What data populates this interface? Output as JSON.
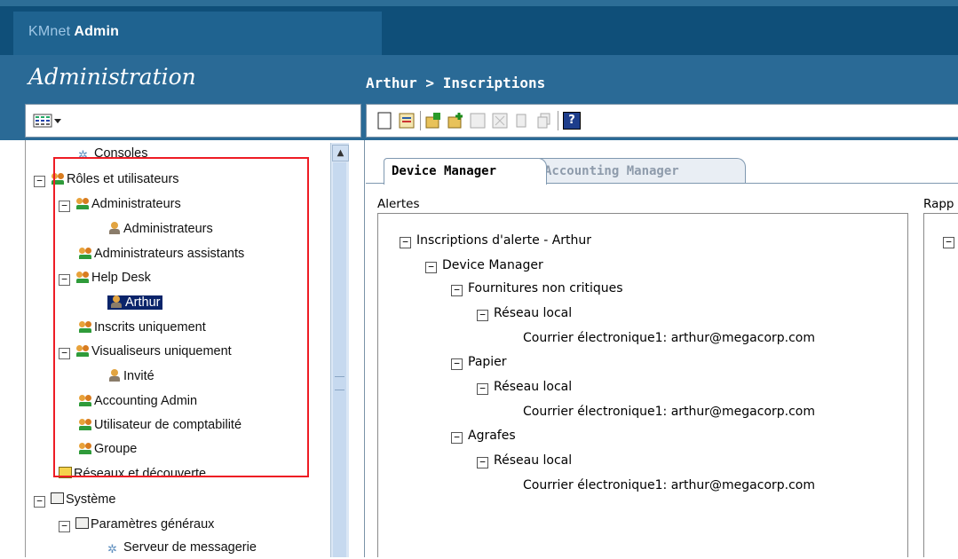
{
  "app": {
    "logo_km": "KMnet",
    "logo_admin": "Admin"
  },
  "left_header": {
    "title": "Administration"
  },
  "right_header": {
    "breadcrumb": "Arthur > Inscriptions"
  },
  "tree": {
    "items": [
      {
        "label": "Consoles"
      },
      {
        "label": "Rôles et utilisateurs"
      },
      {
        "label": "Administrateurs"
      },
      {
        "label": "Administrateurs"
      },
      {
        "label": "Administrateurs assistants"
      },
      {
        "label": "Help Desk"
      },
      {
        "label": "Arthur"
      },
      {
        "label": "Inscrits uniquement"
      },
      {
        "label": "Visualiseurs uniquement"
      },
      {
        "label": "Invité"
      },
      {
        "label": "Accounting Admin"
      },
      {
        "label": "Utilisateur de comptabilité"
      },
      {
        "label": "Groupe"
      },
      {
        "label": "Réseaux et découverte"
      },
      {
        "label": "Système"
      },
      {
        "label": "Paramètres généraux"
      },
      {
        "label": "Serveur de messagerie"
      }
    ]
  },
  "tabs": [
    {
      "label": "Device Manager"
    },
    {
      "label": "Accounting Manager"
    }
  ],
  "sections": {
    "alerts_label": "Alertes",
    "reports_label": "Rapp"
  },
  "alerts": {
    "root": "Inscriptions d'alerte - Arthur",
    "manager": "Device Manager",
    "groups": [
      {
        "label": "Fournitures non critiques",
        "network": "Réseau local",
        "email": "Courrier électronique1: arthur@megacorp.com"
      },
      {
        "label": "Papier",
        "network": "Réseau local",
        "email": "Courrier électronique1: arthur@megacorp.com"
      },
      {
        "label": "Agrafes",
        "network": "Réseau local",
        "email": "Courrier électronique1: arthur@megacorp.com"
      }
    ]
  },
  "icons": {
    "help": "?",
    "expanded_symbol": "−",
    "scroll_up": "▲"
  },
  "colors": {
    "header_dark": "#0f4f79",
    "header": "#2a6a96",
    "selection": "#0a246a",
    "highlight_box": "#ee1c24"
  }
}
